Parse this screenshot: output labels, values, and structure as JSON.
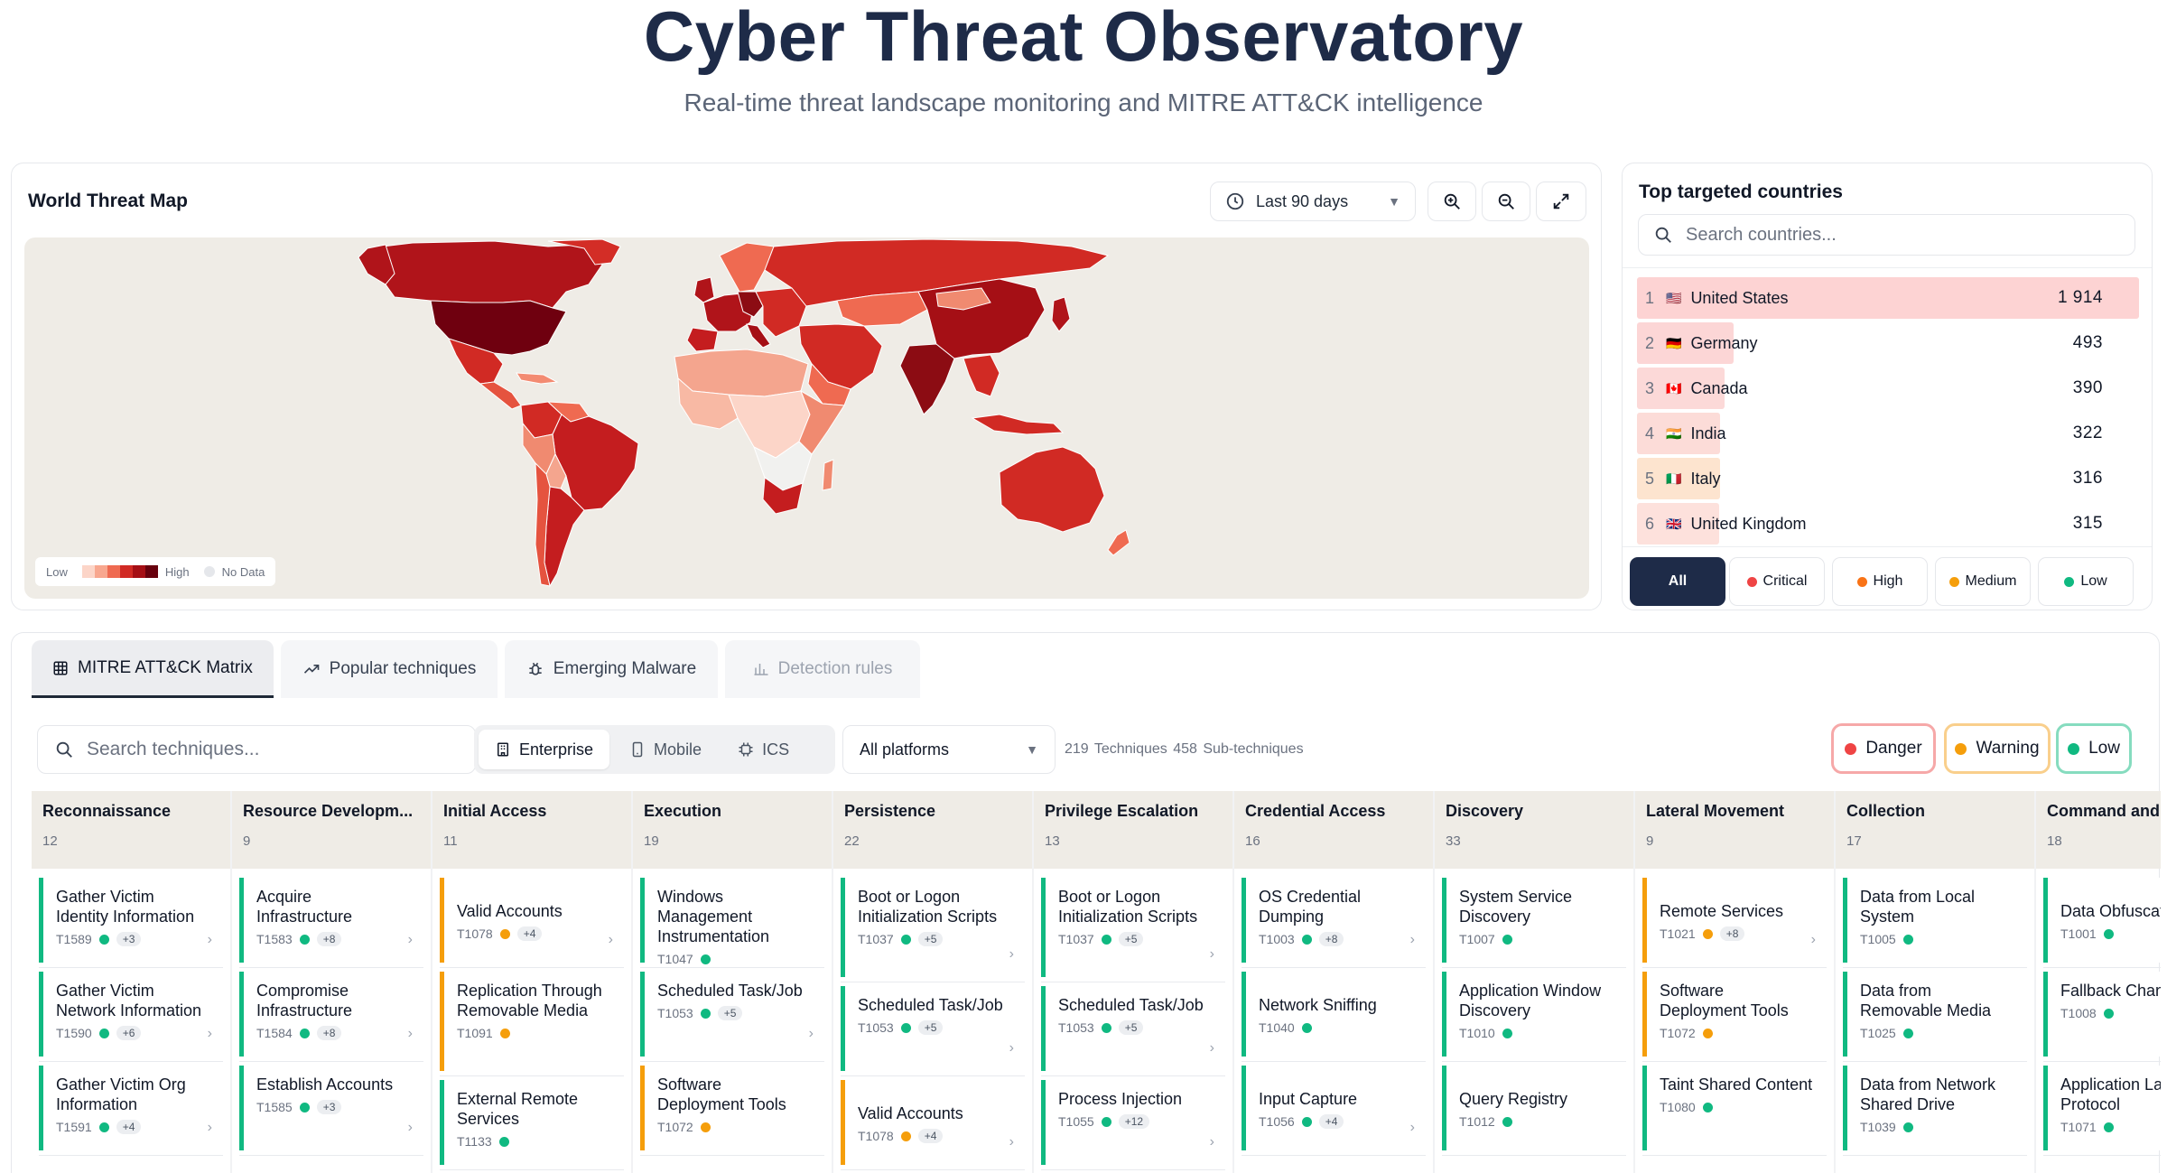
{
  "header": {
    "title": "Cyber Threat Observatory",
    "subtitle": "Real-time threat landscape monitoring and MITRE ATT&CK intelligence"
  },
  "map": {
    "title": "World Threat Map",
    "range_label": "Last 90 days",
    "legend_low": "Low",
    "legend_high": "High",
    "legend_nodata": "No Data",
    "colors": [
      "#fcd5c8",
      "#f8a78f",
      "#ef6a51",
      "#d12a24",
      "#a50f15",
      "#67000d"
    ],
    "nodata_color": "#f1f1ef"
  },
  "countries": {
    "title": "Top targeted countries",
    "search_placeholder": "Search countries...",
    "rows": [
      {
        "rank": "1",
        "flag": "🇺🇸",
        "name": "United States",
        "count": "1 914",
        "share": 1.0,
        "color": "#fdd3d3"
      },
      {
        "rank": "2",
        "flag": "🇩🇪",
        "name": "Germany",
        "count": "493",
        "share": 0.26,
        "color": "#fcd6d6"
      },
      {
        "rank": "3",
        "flag": "🇨🇦",
        "name": "Canada",
        "count": "390",
        "share": 0.2,
        "color": "#fcd9d8"
      },
      {
        "rank": "4",
        "flag": "🇮🇳",
        "name": "India",
        "count": "322",
        "share": 0.17,
        "color": "#fcdcd8"
      },
      {
        "rank": "5",
        "flag": "🇮🇹",
        "name": "Italy",
        "count": "316",
        "share": 0.165,
        "color": "#fde4cf"
      },
      {
        "rank": "6",
        "flag": "🇬🇧",
        "name": "United Kingdom",
        "count": "315",
        "share": 0.164,
        "color": "#fde1dc"
      }
    ],
    "severity_filters": [
      {
        "label": "All",
        "color": ""
      },
      {
        "label": "Critical",
        "color": "#ef4444"
      },
      {
        "label": "High",
        "color": "#f97316"
      },
      {
        "label": "Medium",
        "color": "#f59e0b"
      },
      {
        "label": "Low",
        "color": "#10b981"
      }
    ]
  },
  "tabs": [
    {
      "label": "MITRE ATT&CK Matrix",
      "icon": "grid-icon"
    },
    {
      "label": "Popular techniques",
      "icon": "trending-icon"
    },
    {
      "label": "Emerging Malware",
      "icon": "bug-icon"
    },
    {
      "label": "Detection rules",
      "icon": "bar-chart-icon"
    }
  ],
  "matrix_controls": {
    "search_placeholder": "Search techniques...",
    "segments": [
      "Enterprise",
      "Mobile",
      "ICS"
    ],
    "platform": "All platforms",
    "counts": "219 Techniques  458 Sub-techniques",
    "filters": [
      {
        "label": "Danger",
        "color": "#ef4444",
        "border": "#f6a8a8"
      },
      {
        "label": "Warning",
        "color": "#f59e0b",
        "border": "#f9cf8c"
      },
      {
        "label": "Low",
        "color": "#10b981",
        "border": "#86dcbf"
      }
    ]
  },
  "severity_colors": {
    "g": "#10b981",
    "o": "#f59e0b",
    "r": "#ef4444"
  },
  "matrix": [
    {
      "name": "Reconnaissance",
      "count": "12",
      "items": [
        {
          "name": "Gather Victim Identity Information",
          "id": "T1589",
          "sev": "g",
          "sub": "+3",
          "arrow": true
        },
        {
          "name": "Gather Victim Network Information",
          "id": "T1590",
          "sev": "g",
          "sub": "+6",
          "arrow": true
        },
        {
          "name": "Gather Victim Org Information",
          "id": "T1591",
          "sev": "g",
          "sub": "+4",
          "arrow": true
        }
      ]
    },
    {
      "name": "Resource Developm...",
      "count": "9",
      "items": [
        {
          "name": "Acquire Infrastructure",
          "id": "T1583",
          "sev": "g",
          "sub": "+8",
          "arrow": true
        },
        {
          "name": "Compromise Infrastructure",
          "id": "T1584",
          "sev": "g",
          "sub": "+8",
          "arrow": true
        },
        {
          "name": "Establish Accounts",
          "id": "T1585",
          "sev": "g",
          "sub": "+3",
          "arrow": true
        }
      ]
    },
    {
      "name": "Initial Access",
      "count": "11",
      "items": [
        {
          "name": "Valid Accounts",
          "id": "T1078",
          "sev": "o",
          "sub": "+4",
          "arrow": true
        },
        {
          "name": "Replication Through Removable Media",
          "id": "T1091",
          "sev": "o",
          "sub": "",
          "arrow": false
        },
        {
          "name": "External Remote Services",
          "id": "T1133",
          "sev": "g",
          "sub": "",
          "arrow": false
        }
      ]
    },
    {
      "name": "Execution",
      "count": "19",
      "items": [
        {
          "name": "Windows Management Instrumentation",
          "id": "T1047",
          "sev": "g",
          "sub": "",
          "arrow": false
        },
        {
          "name": "Scheduled Task/Job",
          "id": "T1053",
          "sev": "g",
          "sub": "+5",
          "arrow": true
        },
        {
          "name": "Software Deployment Tools",
          "id": "T1072",
          "sev": "o",
          "sub": "",
          "arrow": false
        }
      ]
    },
    {
      "name": "Persistence",
      "count": "22",
      "items": [
        {
          "name": "Boot or Logon Initialization Scripts",
          "id": "T1037",
          "sev": "g",
          "sub": "+5",
          "arrow": true
        },
        {
          "name": "Scheduled Task/Job",
          "id": "T1053",
          "sev": "g",
          "sub": "+5",
          "arrow": true
        },
        {
          "name": "Valid Accounts",
          "id": "T1078",
          "sev": "o",
          "sub": "+4",
          "arrow": true
        }
      ]
    },
    {
      "name": "Privilege Escalation",
      "count": "13",
      "items": [
        {
          "name": "Boot or Logon Initialization Scripts",
          "id": "T1037",
          "sev": "g",
          "sub": "+5",
          "arrow": true
        },
        {
          "name": "Scheduled Task/Job",
          "id": "T1053",
          "sev": "g",
          "sub": "+5",
          "arrow": true
        },
        {
          "name": "Process Injection",
          "id": "T1055",
          "sev": "g",
          "sub": "+12",
          "arrow": true
        }
      ]
    },
    {
      "name": "Credential Access",
      "count": "16",
      "items": [
        {
          "name": "OS Credential Dumping",
          "id": "T1003",
          "sev": "g",
          "sub": "+8",
          "arrow": true
        },
        {
          "name": "Network Sniffing",
          "id": "T1040",
          "sev": "g",
          "sub": "",
          "arrow": false
        },
        {
          "name": "Input Capture",
          "id": "T1056",
          "sev": "g",
          "sub": "+4",
          "arrow": true
        }
      ]
    },
    {
      "name": "Discovery",
      "count": "33",
      "items": [
        {
          "name": "System Service Discovery",
          "id": "T1007",
          "sev": "g",
          "sub": "",
          "arrow": false
        },
        {
          "name": "Application Window Discovery",
          "id": "T1010",
          "sev": "g",
          "sub": "",
          "arrow": false
        },
        {
          "name": "Query Registry",
          "id": "T1012",
          "sev": "g",
          "sub": "",
          "arrow": false
        }
      ]
    },
    {
      "name": "Lateral Movement",
      "count": "9",
      "items": [
        {
          "name": "Remote Services",
          "id": "T1021",
          "sev": "o",
          "sub": "+8",
          "arrow": true
        },
        {
          "name": "Software Deployment Tools",
          "id": "T1072",
          "sev": "o",
          "sub": "",
          "arrow": false
        },
        {
          "name": "Taint Shared Content",
          "id": "T1080",
          "sev": "g",
          "sub": "",
          "arrow": false
        }
      ]
    },
    {
      "name": "Collection",
      "count": "17",
      "items": [
        {
          "name": "Data from Local System",
          "id": "T1005",
          "sev": "g",
          "sub": "",
          "arrow": false
        },
        {
          "name": "Data from Removable Media",
          "id": "T1025",
          "sev": "g",
          "sub": "",
          "arrow": false
        },
        {
          "name": "Data from Network Shared Drive",
          "id": "T1039",
          "sev": "g",
          "sub": "",
          "arrow": false
        }
      ]
    },
    {
      "name": "Command and Control",
      "count": "18",
      "items": [
        {
          "name": "Data Obfuscation",
          "id": "T1001",
          "sev": "g",
          "sub": "",
          "arrow": false
        },
        {
          "name": "Fallback Channels",
          "id": "T1008",
          "sev": "g",
          "sub": "",
          "arrow": false
        },
        {
          "name": "Application Layer Protocol",
          "id": "T1071",
          "sev": "g",
          "sub": "",
          "arrow": false
        }
      ]
    }
  ]
}
